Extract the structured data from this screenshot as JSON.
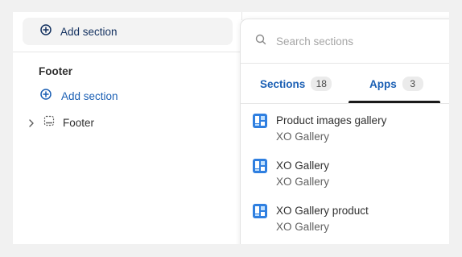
{
  "left_panel": {
    "add_section_label": "Add section",
    "footer_group": {
      "heading": "Footer",
      "add_section_label": "Add section",
      "items": [
        {
          "label": "Footer"
        }
      ]
    }
  },
  "popover": {
    "search": {
      "placeholder": "Search sections",
      "value": ""
    },
    "tabs": [
      {
        "label": "Sections",
        "count": "18",
        "active": false
      },
      {
        "label": "Apps",
        "count": "3",
        "active": true
      }
    ],
    "apps": [
      {
        "name": "Product images gallery",
        "vendor": "XO Gallery"
      },
      {
        "name": "XO Gallery",
        "vendor": "XO Gallery"
      },
      {
        "name": "XO Gallery product",
        "vendor": "XO Gallery"
      }
    ]
  },
  "colors": {
    "accent_dark": "#12305f",
    "link_blue": "#1a5fb4",
    "app_icon_blue": "#2f7fe0"
  }
}
